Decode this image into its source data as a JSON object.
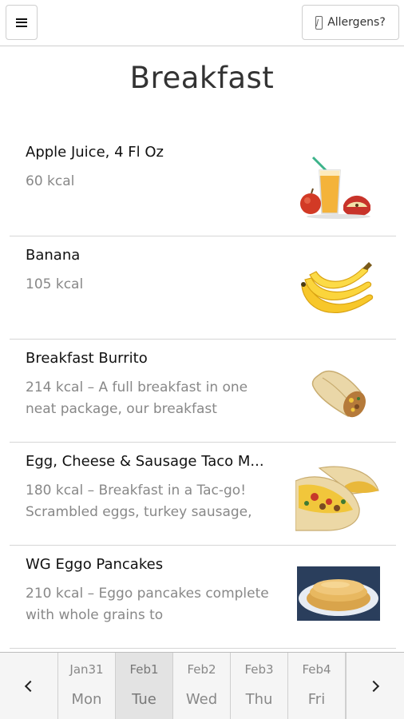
{
  "header": {
    "allergens_label": "Allergens?"
  },
  "page_title": "Breakfast",
  "items": [
    {
      "name": "Apple Juice, 4 Fl Oz",
      "desc": "60 kcal"
    },
    {
      "name": "Banana",
      "desc": "105 kcal"
    },
    {
      "name": "Breakfast Burrito",
      "desc": "214 kcal – A full breakfast in one neat package, our breakfast"
    },
    {
      "name": "Egg, Cheese & Sausage Taco M...",
      "desc": "180 kcal – Breakfast in a Tac-go! Scrambled eggs, turkey sausage,"
    },
    {
      "name": "WG Eggo Pancakes",
      "desc": "210 kcal – Eggo pancakes complete with whole grains to"
    }
  ],
  "dates": [
    {
      "date": "Jan31",
      "weekday": "Mon"
    },
    {
      "date": "Feb1",
      "weekday": "Tue"
    },
    {
      "date": "Feb2",
      "weekday": "Wed"
    },
    {
      "date": "Feb3",
      "weekday": "Thu"
    },
    {
      "date": "Feb4",
      "weekday": "Fri"
    }
  ],
  "selected_date": "Feb1",
  "icons": {
    "menu": "hamburger-icon",
    "allergens": "allergen-icon",
    "prev": "chevron-left-icon",
    "next": "chevron-right-icon"
  }
}
